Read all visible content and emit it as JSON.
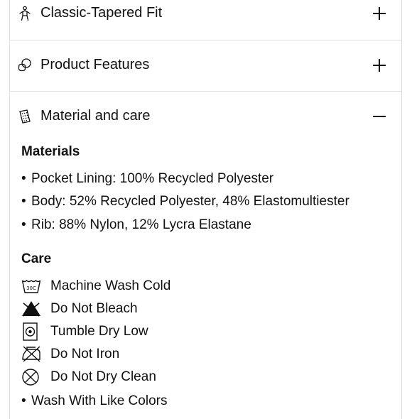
{
  "accordion": {
    "fit": {
      "title": "Classic-Tapered Fit",
      "toggle": "+",
      "icon": "person-fit-icon"
    },
    "features": {
      "title": "Product Features",
      "toggle": "+",
      "icon": "features-icon"
    },
    "material": {
      "title": "Material and care",
      "toggle": "−",
      "icon": "fabric-icon"
    }
  },
  "materials": {
    "heading": "Materials",
    "items": [
      "Pocket Lining: 100% Recycled Polyester",
      "Body: 52% Recycled Polyester, 48% Elastomultiester",
      "Rib: 88% Nylon, 12% Lycra Elastane"
    ]
  },
  "care": {
    "heading": "Care",
    "items": [
      {
        "label": "Machine Wash Cold",
        "icon": "wash-30-icon",
        "icon_text": "30C"
      },
      {
        "label": "Do Not Bleach",
        "icon": "no-bleach-icon"
      },
      {
        "label": "Tumble Dry Low",
        "icon": "tumble-dry-low-icon"
      },
      {
        "label": "Do Not Iron",
        "icon": "no-iron-icon"
      },
      {
        "label": "Do Not Dry Clean",
        "icon": "no-dry-clean-icon"
      }
    ],
    "extra": "Wash With Like Colors"
  }
}
